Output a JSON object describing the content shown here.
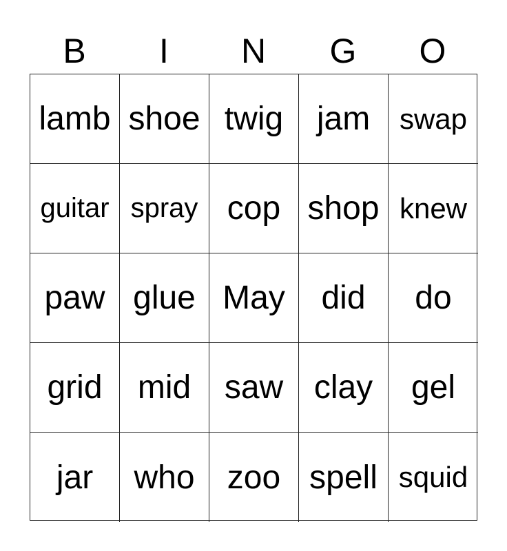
{
  "header": [
    "B",
    "I",
    "N",
    "G",
    "O"
  ],
  "rows": [
    [
      "lamb",
      "shoe",
      "twig",
      "jam",
      "swap"
    ],
    [
      "guitar",
      "spray",
      "cop",
      "shop",
      "knew"
    ],
    [
      "paw",
      "glue",
      "May",
      "did",
      "do"
    ],
    [
      "grid",
      "mid",
      "saw",
      "clay",
      "gel"
    ],
    [
      "jar",
      "who",
      "zoo",
      "spell",
      "squid"
    ]
  ]
}
